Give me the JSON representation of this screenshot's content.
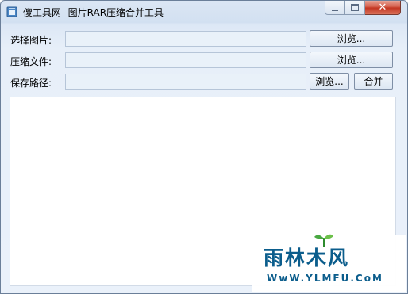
{
  "window": {
    "title": "傻工具网--图片RAR压缩合并工具",
    "caption": {
      "minimize_icon": "minimize-icon",
      "maximize_icon": "maximize-icon",
      "close_label": "✕"
    }
  },
  "form": {
    "select_image_label": "选择图片:",
    "compressed_file_label": "压缩文件:",
    "save_path_label": "保存路径:",
    "select_image_value": "",
    "compressed_file_value": "",
    "save_path_value": "",
    "browse_label": "浏览...",
    "merge_label": "合并"
  },
  "output": {
    "text": ""
  },
  "watermark": {
    "brand": "雨林木风",
    "url": "WwW.YLMFU.CoM",
    "color": "#0b5d8c"
  },
  "colors": {
    "window_bg": "#e7eff9",
    "field_bg": "#e9f1f9",
    "close_red": "#c2331f"
  }
}
